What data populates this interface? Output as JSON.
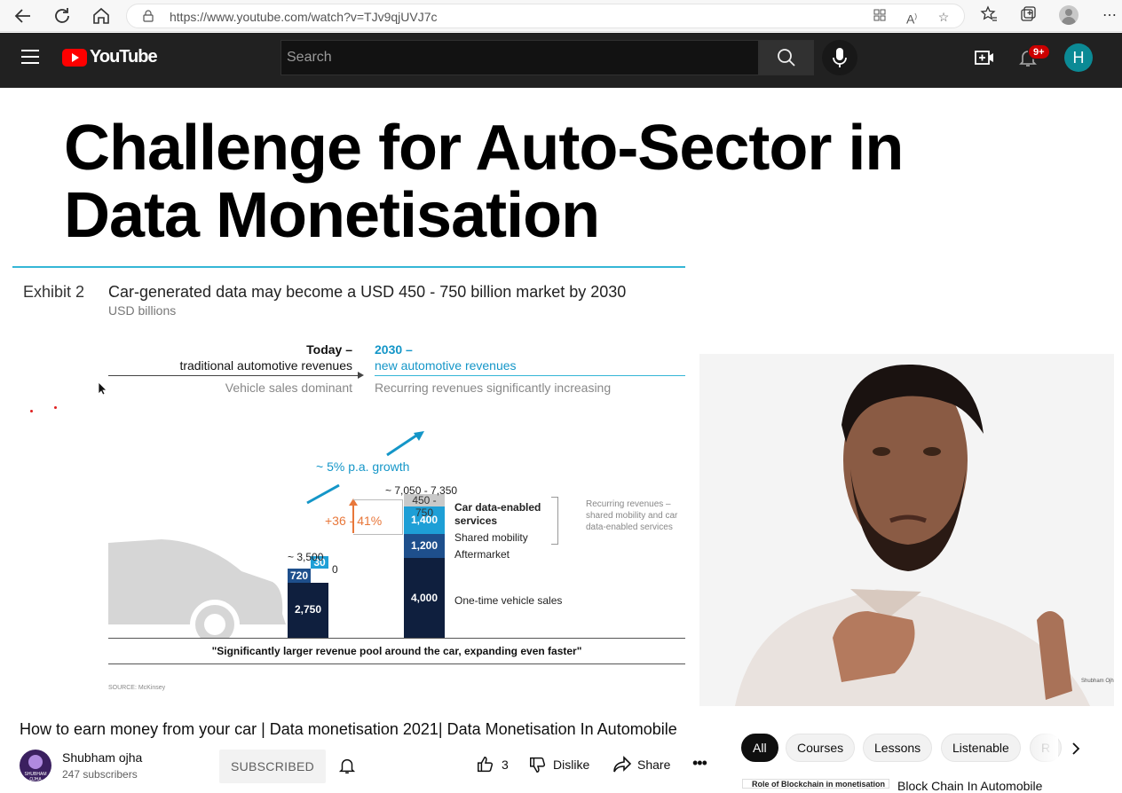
{
  "browser": {
    "url": "https://www.youtube.com/watch?v=TJv9qjUVJ7c",
    "toolbar_icons": [
      "back-icon",
      "refresh-icon",
      "home-icon",
      "lock-icon",
      "apps-icon",
      "read-aloud-icon",
      "add-favorite-icon",
      "favorites-icon",
      "collections-icon",
      "profile-icon",
      "more-icon"
    ]
  },
  "youtube": {
    "logo": "YouTube",
    "search_placeholder": "Search",
    "notification_count": "9+",
    "avatar_letter": "H"
  },
  "slide": {
    "title_line1": "Challenge for Auto-Sector in",
    "title_line2": "Data Monetisation",
    "exhibit": "Exhibit 2",
    "headline": "Car-generated data may become a USD 450 - 750 billion market by 2030",
    "unit": "USD billions",
    "today_bold": "Today –",
    "today_sub": "traditional automotive revenues",
    "future_bold": "2030 –",
    "future_sub": "new automotive revenues",
    "vehicle_note": "Vehicle sales dominant",
    "recurring_note": "Recurring revenues significantly increasing",
    "growth": "~ 5% p.a. growth",
    "increase": "+36 - 41%",
    "quote": "\"Significantly larger revenue pool around the car, expanding even faster\"",
    "source": "SOURCE: McKinsey",
    "recurring_bracket": [
      "Recurring revenues –",
      "shared mobility and car",
      "data-enabled services"
    ]
  },
  "chart_data": {
    "type": "bar",
    "stacked": true,
    "unit": "USD billions",
    "categories": [
      "Today",
      "2030"
    ],
    "totals": [
      "~ 3,500",
      "~ 7,050 - 7,350"
    ],
    "series": [
      {
        "name": "One-time vehicle sales",
        "values": [
          2750,
          4000
        ],
        "labels": [
          "2,750",
          "4,000"
        ],
        "color": "#0f1f3e"
      },
      {
        "name": "Aftermarket",
        "values": [
          720,
          1200
        ],
        "labels": [
          "720",
          "1,200"
        ],
        "color": "#1e4f8c"
      },
      {
        "name": "Shared mobility",
        "values": [
          30,
          1400
        ],
        "labels": [
          "30",
          "1,400"
        ],
        "color": "#1e9fd6"
      },
      {
        "name": "Car data-enabled services",
        "values": [
          0,
          600
        ],
        "labels": [
          "0",
          "450 - 750"
        ],
        "color": "#c9c9c9"
      }
    ],
    "segment_labels": {
      "services_line1": "Car data-enabled",
      "services_line2": "services",
      "shared": "Shared mobility",
      "aftermarket": "Aftermarket",
      "vehicle": "One-time vehicle sales"
    }
  },
  "video": {
    "title": "How to earn money from your car | Data monetisation 2021| Data Monetisation In Automobile",
    "channel": "Shubham ojha",
    "channel_avatar_text": "SHUBHAM OJHA",
    "subscribers": "247 subscribers",
    "subscribe_label": "SUBSCRIBED",
    "likes": "3",
    "dislike_label": "Dislike",
    "share_label": "Share"
  },
  "chips": [
    "All",
    "Courses",
    "Lessons",
    "Listenable",
    "R"
  ],
  "suggestion": {
    "thumb_text": "Role of Blockchain in monetisation",
    "title": "Block Chain In Automobile"
  }
}
